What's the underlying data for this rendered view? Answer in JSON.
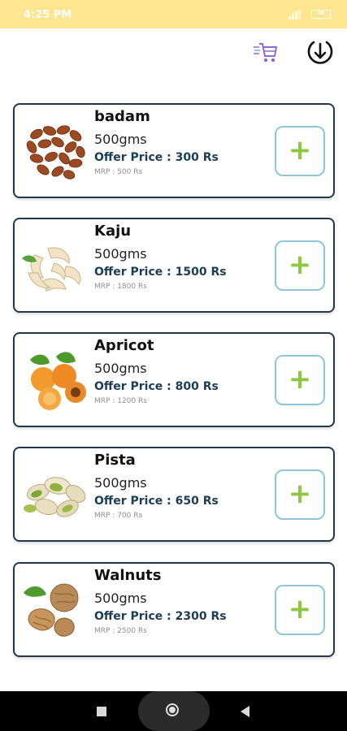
{
  "status_bar": {
    "time": "4:25 PM",
    "battery": "86"
  },
  "toolbar": {
    "cart_icon": "fast-cart-icon",
    "download_icon": "download-circle-icon"
  },
  "products": [
    {
      "name": "badam",
      "qty": "500gms",
      "offer": "Offer Price : 300 Rs",
      "mrp": "MRP : 500 Rs",
      "image": "almonds"
    },
    {
      "name": "Kaju",
      "qty": "500gms",
      "offer": "Offer Price : 1500 Rs",
      "mrp": "MRP : 1800 Rs",
      "image": "cashews"
    },
    {
      "name": "Apricot",
      "qty": "500gms",
      "offer": "Offer Price : 800 Rs",
      "mrp": "MRP : 1200 Rs",
      "image": "apricots"
    },
    {
      "name": "Pista",
      "qty": "500gms",
      "offer": "Offer Price : 650 Rs",
      "mrp": "MRP : 700 Rs",
      "image": "pistachios"
    },
    {
      "name": "Walnuts",
      "qty": "500gms",
      "offer": "Offer Price : 2300 Rs",
      "mrp": "MRP : 2500 Rs",
      "image": "walnuts"
    }
  ],
  "add_label": "+",
  "colors": {
    "status_bar": "#fde68f",
    "card_border": "#1f3a4d",
    "add_border": "#8fc6d6",
    "plus": "#8dc73f",
    "offer_text": "#1b3d55"
  },
  "nav_icons": [
    "recents-square-icon",
    "home-circle-icon",
    "back-triangle-icon"
  ]
}
